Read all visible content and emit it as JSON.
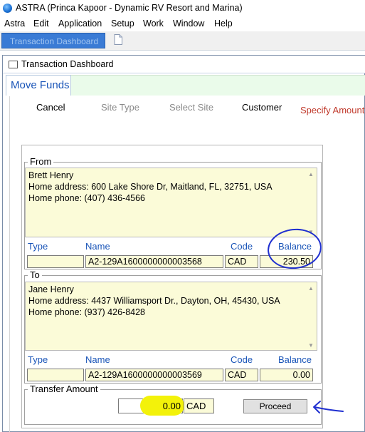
{
  "app": {
    "title": "ASTRA (Princa Kapoor - Dynamic RV Resort and Marina)"
  },
  "menu": [
    "Astra",
    "Edit",
    "Application",
    "Setup",
    "Work",
    "Window",
    "Help"
  ],
  "tabs": {
    "active": "Transaction Dashboard",
    "new_tab_icon": "document-icon"
  },
  "window": {
    "title": "Transaction Dashboard"
  },
  "section": {
    "title": "Move Funds"
  },
  "steps": {
    "cancel": "Cancel",
    "site_type": "Site Type",
    "select_site": "Select Site",
    "customer": "Customer",
    "specify_amount": "Specify Amount"
  },
  "from": {
    "legend": "From",
    "name": "Brett Henry",
    "address": "Home address: 600 Lake Shore Dr, Maitland, FL, 32751, USA",
    "phone": "Home phone: (407) 436-4566",
    "headers": {
      "type": "Type",
      "name": "Name",
      "code": "Code",
      "balance": "Balance"
    },
    "type": "",
    "account_name": "A2-129A1600000000003568",
    "code": "CAD",
    "balance": "230.50"
  },
  "to": {
    "legend": "To",
    "name": "Jane Henry",
    "address": "Home address: 4437 Williamsport Dr., Dayton, OH, 45430, USA",
    "phone": "Home phone: (937) 426-8428",
    "headers": {
      "type": "Type",
      "name": "Name",
      "code": "Code",
      "balance": "Balance"
    },
    "type": "",
    "account_name": "A2-129A1600000000003569",
    "code": "CAD",
    "balance": "0.00"
  },
  "transfer": {
    "legend": "Transfer Amount",
    "amount": "0.00",
    "currency": "CAD",
    "proceed_label": "Proceed"
  },
  "colors": {
    "link_blue": "#1a55b8",
    "active_step": "#c0392b",
    "field_yellow": "#fbfbd8",
    "highlight": "#f3f20a",
    "annotation": "#1f2fd0"
  }
}
